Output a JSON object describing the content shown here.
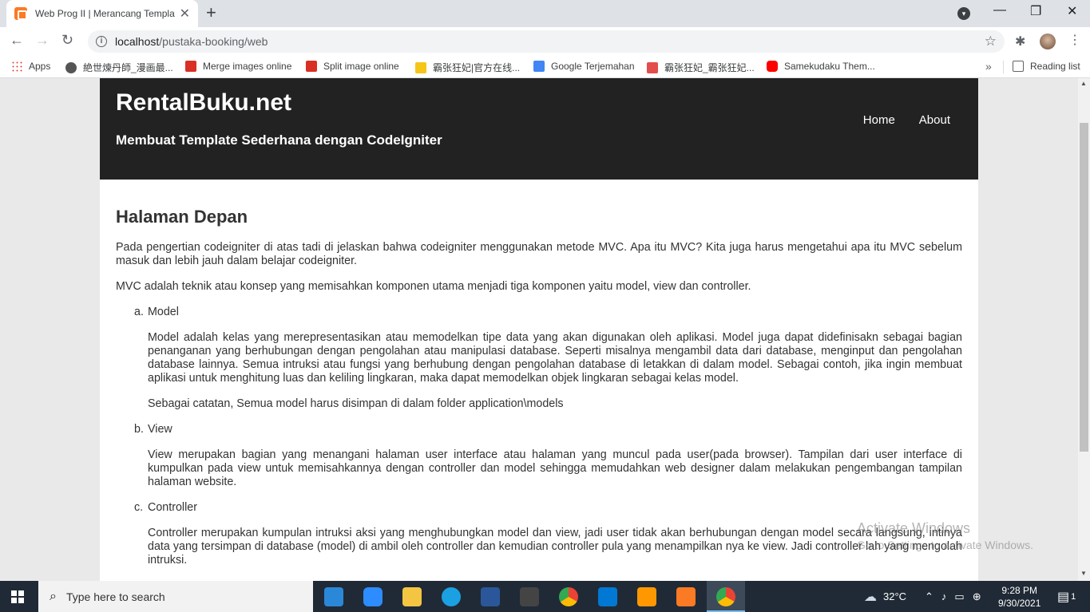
{
  "browser": {
    "tab_title": "Web Prog II | Merancang Templat",
    "tab_close": "✕",
    "new_tab": "+",
    "url_host": "localhost",
    "url_path": "/pustaka-booking/web",
    "window_controls": {
      "minimize": "—",
      "restore": "❐",
      "close": "✕"
    }
  },
  "bookmarks": {
    "apps": "Apps",
    "items": [
      {
        "label": "絶世煉丹師_漫画最...",
        "color": "#555555"
      },
      {
        "label": "Merge images online",
        "color": "#d93025"
      },
      {
        "label": "Split image online",
        "color": "#d93025"
      },
      {
        "label": "霸张狂妃|官方在线...",
        "color": "#f5c518"
      },
      {
        "label": "Google Terjemahan",
        "color": "#4285f4"
      },
      {
        "label": "霸张狂妃_霸张狂妃...",
        "color": "#e44d4d"
      },
      {
        "label": "Samekudaku Them...",
        "color": "#ff0000"
      }
    ],
    "more": "»",
    "reading_list": "Reading list"
  },
  "site": {
    "brand": "RentalBuku.net",
    "tagline": "Membuat Template Sederhana dengan CodeIgniter",
    "menu": [
      "Home",
      "About"
    ]
  },
  "content": {
    "heading": "Halaman Depan",
    "intro": "Pada pengertian codeigniter di atas tadi di jelaskan bahwa codeigniter menggunakan metode MVC. Apa itu MVC? Kita juga harus mengetahui apa itu MVC sebelum masuk dan lebih jauh dalam belajar codeigniter.",
    "mvc": "MVC adalah teknik atau konsep yang memisahkan komponen utama menjadi tiga komponen yaitu model, view dan controller.",
    "items": [
      {
        "marker": "a.",
        "title": "Model",
        "paragraphs": [
          "Model adalah kelas yang merepresentasikan atau memodelkan tipe data yang akan digunakan oleh aplikasi. Model juga dapat didefinisakn sebagai bagian penanganan yang berhubungan dengan pengolahan atau manipulasi database. Seperti misalnya mengambil data dari database, menginput dan pengolahan database lainnya. Semua intruksi atau fungsi yang berhubung dengan pengolahan database di letakkan di dalam model. Sebagai contoh, jika ingin membuat aplikasi untuk menghitung luas dan keliling lingkaran, maka dapat memodelkan objek lingkaran sebagai kelas model.",
          "Sebagai catatan, Semua model harus disimpan di dalam folder application\\models"
        ]
      },
      {
        "marker": "b.",
        "title": "View",
        "paragraphs": [
          "View merupakan bagian yang menangani halaman user interface atau halaman yang muncul pada user(pada browser). Tampilan dari user interface di kumpulkan pada view untuk memisahkannya dengan controller dan model sehingga memudahkan web designer dalam melakukan pengembangan tampilan halaman website."
        ]
      },
      {
        "marker": "c.",
        "title": "Controller",
        "paragraphs": [
          "Controller merupakan kumpulan intruksi aksi yang menghubungkan model dan view, jadi user tidak akan berhubungan dengan model secara langsung, intinya data yang tersimpan di database (model) di ambil oleh controller dan kemudian controller pula yang menampilkan nya ke view. Jadi controller lah yang mengolah intruksi."
        ]
      }
    ]
  },
  "watermark": {
    "line1": "Activate Windows",
    "line2": "Go to Settings to activate Windows."
  },
  "taskbar": {
    "search_placeholder": "Type here to search",
    "temperature": "32°C",
    "time": "9:28 PM",
    "date": "9/30/2021",
    "notifications": "1"
  }
}
